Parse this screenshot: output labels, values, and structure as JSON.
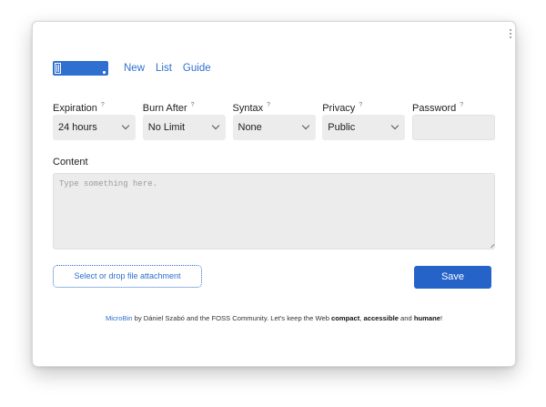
{
  "nav": {
    "links": [
      "New",
      "List",
      "Guide"
    ]
  },
  "form": {
    "expiration": {
      "label": "Expiration",
      "help": "?",
      "value": "24 hours"
    },
    "burn_after": {
      "label": "Burn After",
      "help": "?",
      "value": "No Limit"
    },
    "syntax": {
      "label": "Syntax",
      "help": "?",
      "value": "None"
    },
    "privacy": {
      "label": "Privacy",
      "help": "?",
      "value": "Public"
    },
    "password": {
      "label": "Password",
      "help": "?",
      "value": ""
    },
    "content": {
      "label": "Content",
      "placeholder": "Type something here."
    },
    "attach_label": "Select or drop file attachment",
    "save_label": "Save"
  },
  "footer": {
    "brand": "MicroBin",
    "text1": " by Dániel Szabó and the FOSS Community. Let's keep the Web ",
    "compact": "compact",
    "sep1": ", ",
    "accessible": "accessible",
    "sep2": " and ",
    "humane": "humane",
    "end": "!"
  },
  "colors": {
    "accent": "#2f6fd0",
    "save_button": "#2563c9",
    "input_bg": "#ececec"
  },
  "icons": {
    "logo": "microbin-logo",
    "dropdown": "chevron-down-icon"
  }
}
